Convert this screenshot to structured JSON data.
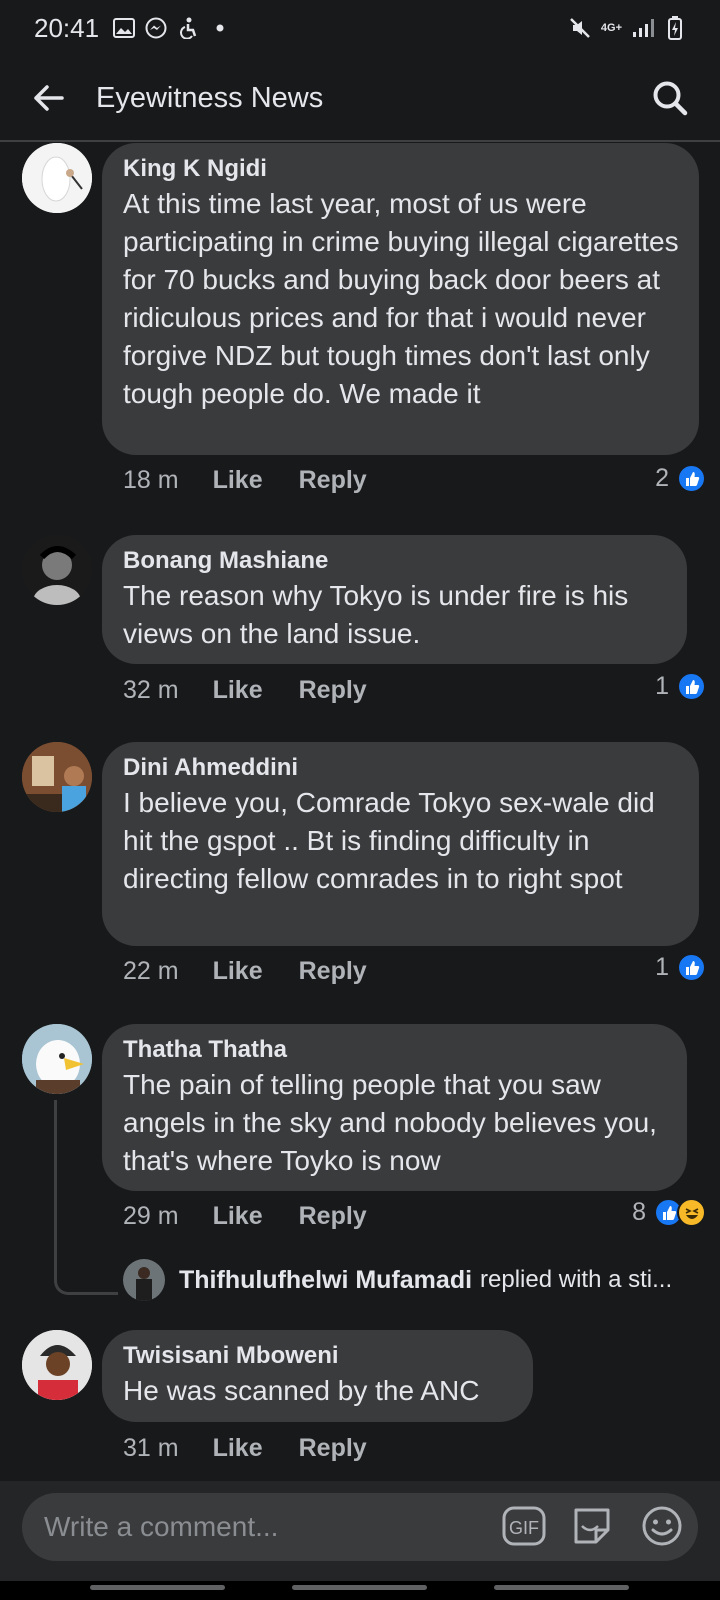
{
  "status": {
    "time": "20:41",
    "network": "4G+"
  },
  "header": {
    "title": "Eyewitness News"
  },
  "comments": [
    {
      "author": "King K Ngidi",
      "text": "At this time last year, most of us were participating in crime buying illegal cigarettes for 70 bucks and buying back door beers at ridiculous prices and for that i would never forgive NDZ but tough times don't last only tough people do. We made it",
      "time": "18 m",
      "like_label": "Like",
      "reply_label": "Reply",
      "reaction_count": "2",
      "reactions": [
        "like"
      ]
    },
    {
      "author": "Bonang Mashiane",
      "text": "The reason why Tokyo is under fire is his views on the land issue.",
      "time": "32 m",
      "like_label": "Like",
      "reply_label": "Reply",
      "reaction_count": "1",
      "reactions": [
        "like"
      ]
    },
    {
      "author": "Dini Ahmeddini",
      "text": "I believe you, Comrade Tokyo sex-wale did hit the gspot .. Bt is finding difficulty in directing fellow comrades in to right spot",
      "time": "22 m",
      "like_label": "Like",
      "reply_label": "Reply",
      "reaction_count": "1",
      "reactions": [
        "like"
      ]
    },
    {
      "author": "Thatha Thatha",
      "text": "The pain of telling people that you saw angels in the sky and nobody believes you, that's where Toyko is now",
      "time": "29 m",
      "like_label": "Like",
      "reply_label": "Reply",
      "reaction_count": "8",
      "reactions": [
        "like",
        "haha"
      ],
      "reply_preview": {
        "author": "Thifhulufhelwi Mufamadi",
        "note": "replied with a sti..."
      }
    },
    {
      "author": "Twisisani Mboweni",
      "text": "He was scanned by the ANC",
      "time": "31 m",
      "like_label": "Like",
      "reply_label": "Reply"
    }
  ],
  "composer": {
    "placeholder": "Write a comment...",
    "gif_label": "GIF"
  },
  "colors": {
    "background": "#18191a",
    "bubble": "#3a3b3c",
    "accent": "#1877f2",
    "muted_text": "#b0b3b8"
  }
}
